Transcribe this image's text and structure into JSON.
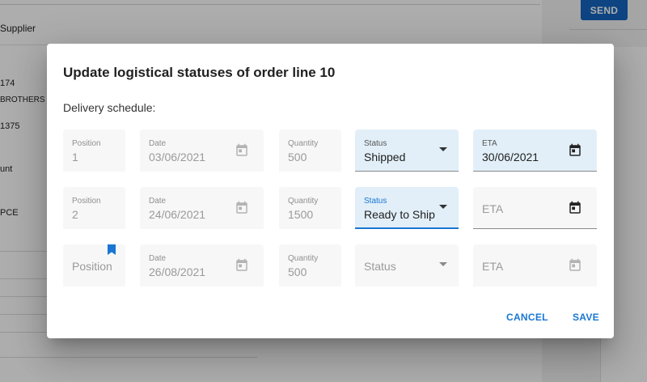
{
  "background": {
    "header_label": "Supplier",
    "rows": [
      "174",
      "BROTHERS S",
      "1375",
      "unt",
      "PCE"
    ],
    "send_label": "SEND"
  },
  "dialog": {
    "title": "Update logistical statuses of order line 10",
    "section_label": "Delivery schedule:",
    "rows": [
      {
        "position": {
          "label": "Position",
          "value": "1"
        },
        "date": {
          "label": "Date",
          "value": "03/06/2021",
          "icon": "calendar-icon"
        },
        "quantity": {
          "label": "Quantity",
          "value": "500"
        },
        "status": {
          "label": "Status",
          "value": "Shipped",
          "icon": "dropdown-arrow-icon"
        },
        "eta": {
          "label": "ETA",
          "value": "30/06/2021",
          "icon": "calendar-icon"
        }
      },
      {
        "position": {
          "label": "Position",
          "value": "2"
        },
        "date": {
          "label": "Date",
          "value": "24/06/2021",
          "icon": "calendar-icon"
        },
        "quantity": {
          "label": "Quantity",
          "value": "1500"
        },
        "status": {
          "label": "Status",
          "value": "Ready to Ship",
          "icon": "dropdown-arrow-icon"
        },
        "eta": {
          "placeholder": "ETA",
          "icon": "calendar-icon"
        }
      },
      {
        "position": {
          "placeholder": "Position",
          "icon": "bookmark-icon"
        },
        "date": {
          "label": "Date",
          "value": "26/08/2021",
          "icon": "calendar-icon"
        },
        "quantity": {
          "label": "Quantity",
          "value": "500"
        },
        "status": {
          "placeholder": "Status",
          "icon": "dropdown-arrow-icon"
        },
        "eta": {
          "placeholder": "ETA",
          "icon": "calendar-icon"
        }
      }
    ],
    "actions": {
      "cancel": "CANCEL",
      "save": "SAVE"
    }
  },
  "colors": {
    "accent": "#1976d2",
    "active_field_bg": "#e2eff8",
    "send_button": "#1565c0"
  }
}
